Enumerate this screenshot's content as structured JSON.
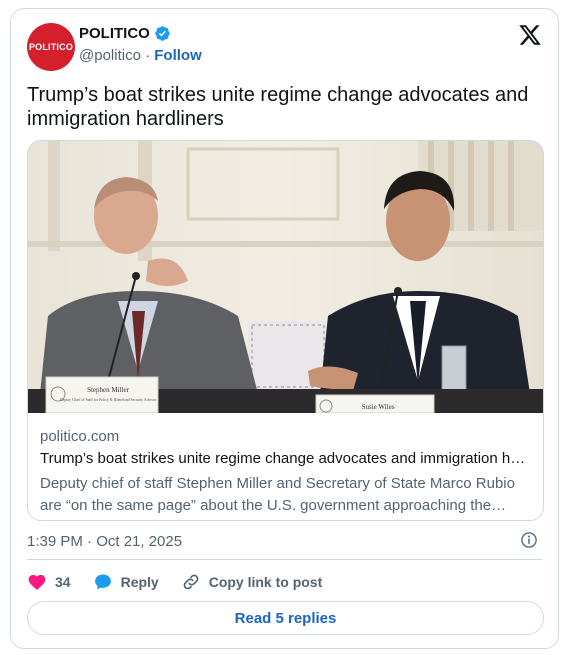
{
  "author": {
    "avatar_text": "POLITICO",
    "name": "POLITICO",
    "handle": "@politico",
    "separator": " · ",
    "follow_label": "Follow"
  },
  "tweet": {
    "text": "Trump’s boat strikes unite regime change advocates and immigration hardliners"
  },
  "link_card": {
    "nameplate_left_name": "Stephen Miller",
    "nameplate_left_title": "Deputy Chief of Staff for Policy & Homeland Security Advisor",
    "nameplate_right_name": "Susie Wiles",
    "domain": "politico.com",
    "title": "Trump’s boat strikes unite regime change advocates and immigration hardliners",
    "description": "Deputy chief of staff Stephen Miller and Secretary of State Marco Rubio are “on the same page” about the U.S. government approaching the Venezuela issue."
  },
  "timestamp": "1:39 PM · Oct 21, 2025",
  "actions": {
    "like_count": "34",
    "reply_label": "Reply",
    "copy_label": "Copy link to post"
  },
  "read_replies_label": "Read 5 replies",
  "colors": {
    "brand_red": "#d4202c",
    "link_blue": "#1d64c4",
    "verified_blue": "#1d9bf0",
    "like_pink": "#f91880",
    "muted_text": "#536471"
  },
  "icons": [
    "verified-badge-icon",
    "x-logo-icon",
    "info-icon",
    "heart-icon",
    "reply-bubble-icon",
    "link-icon"
  ]
}
